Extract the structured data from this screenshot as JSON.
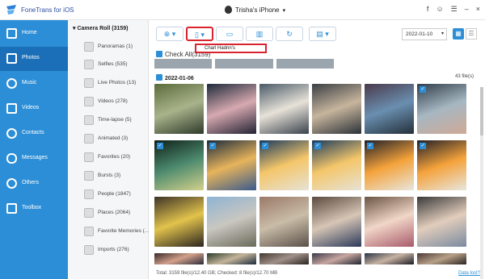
{
  "app": {
    "title": "FoneTrans for iOS",
    "device": "Trisha's iPhone"
  },
  "window_icons": [
    "f",
    "☺",
    "☰",
    "–",
    "×"
  ],
  "sidebar": {
    "items": [
      {
        "label": "Home",
        "icon": "home-icon"
      },
      {
        "label": "Photos",
        "icon": "photos-icon",
        "active": true
      },
      {
        "label": "Music",
        "icon": "music-icon"
      },
      {
        "label": "Videos",
        "icon": "videos-icon"
      },
      {
        "label": "Contacts",
        "icon": "contacts-icon"
      },
      {
        "label": "Messages",
        "icon": "messages-icon"
      },
      {
        "label": "Others",
        "icon": "others-icon"
      },
      {
        "label": "Toolbox",
        "icon": "toolbox-icon"
      }
    ]
  },
  "albums": {
    "header": "Camera Roll (3159)",
    "items": [
      "Panoramas (1)",
      "Selfies (535)",
      "Live Photos (13)",
      "Videos (278)",
      "Time-lapse (5)",
      "Animated (3)",
      "Favorites (20)",
      "Bursts (3)",
      "People (1847)",
      "Places (2064)",
      "Favorite Memories (...",
      "Imports (276)"
    ]
  },
  "toolbar": {
    "date_value": "2022-01-10",
    "tooltip": "Charl Hadnn's",
    "check_all": "Check All(3159)"
  },
  "photos": {
    "date_label": "2022-01-06",
    "file_count": "43 file(s)",
    "items": [
      {
        "checked": false,
        "colors": [
          "#5b6b3a",
          "#a9b38b",
          "#2e3a2a"
        ]
      },
      {
        "checked": false,
        "colors": [
          "#1e2a3a",
          "#d7a9b0",
          "#223"
        ]
      },
      {
        "checked": false,
        "colors": [
          "#4a5a68",
          "#e7e2d8",
          "#39424c"
        ]
      },
      {
        "checked": false,
        "colors": [
          "#3a3f44",
          "#c7b59d",
          "#2b3238"
        ]
      },
      {
        "checked": false,
        "colors": [
          "#4a3a4c",
          "#6a8fb0",
          "#23303a"
        ]
      },
      {
        "checked": true,
        "colors": [
          "#2f3e4a",
          "#a7b7c2",
          "#cfa996"
        ]
      },
      {
        "checked": true,
        "colors": [
          "#0f2018",
          "#4c8a6e",
          "#d3d08a"
        ]
      },
      {
        "checked": true,
        "colors": [
          "#1b2a3c",
          "#e7b45b",
          "#3a5a8c"
        ]
      },
      {
        "checked": true,
        "colors": [
          "#1a3a5c",
          "#f4c66a",
          "#e6e2d6"
        ]
      },
      {
        "checked": true,
        "colors": [
          "#1a3a5c",
          "#f4c66a",
          "#e6e2d6"
        ]
      },
      {
        "checked": true,
        "colors": [
          "#1f1f28",
          "#f4a23a",
          "#e8e6de"
        ]
      },
      {
        "checked": true,
        "colors": [
          "#1f1f28",
          "#f4a23a",
          "#e8e6de"
        ]
      },
      {
        "checked": false,
        "colors": [
          "#3d3328",
          "#e2c34c",
          "#2a2520"
        ]
      },
      {
        "checked": false,
        "colors": [
          "#8fb3d4",
          "#c9c7c0",
          "#6a6a5a"
        ]
      },
      {
        "checked": false,
        "colors": [
          "#9a7a68",
          "#c9bca8",
          "#5a5048"
        ]
      },
      {
        "checked": false,
        "colors": [
          "#5a4a3e",
          "#d7c6b6",
          "#2a3a5a"
        ]
      },
      {
        "checked": false,
        "colors": [
          "#6b5444",
          "#f1d7c8",
          "#a85a6a"
        ]
      },
      {
        "checked": false,
        "colors": [
          "#3a3a3a",
          "#e2cdbc",
          "#7a8aa0"
        ]
      },
      {
        "checked": false,
        "colors": [
          "#3a2a2a",
          "#d2a08a",
          "#2a2a3a"
        ]
      },
      {
        "checked": false,
        "colors": [
          "#2a3a2a",
          "#c4b49a",
          "#1a2a3a"
        ]
      },
      {
        "checked": false,
        "colors": [
          "#42382e",
          "#a0908a",
          "#2a241e"
        ]
      },
      {
        "checked": false,
        "colors": [
          "#3a3a48",
          "#c8a6a0",
          "#1e2430"
        ]
      },
      {
        "checked": false,
        "colors": [
          "#2a3244",
          "#c7b3a2",
          "#1a1a22"
        ]
      },
      {
        "checked": false,
        "colors": [
          "#4a3a34",
          "#b7a088",
          "#2a2220"
        ]
      }
    ]
  },
  "status": {
    "text": "Total: 3159 file(s)/12.40 GB; Checked: 8 file(s)/12.70 MB",
    "link": "Data lost?"
  },
  "colors": {
    "accent": "#2c8ed6",
    "sidebar_active": "#1a6fb8",
    "highlight": "#d9232f"
  }
}
